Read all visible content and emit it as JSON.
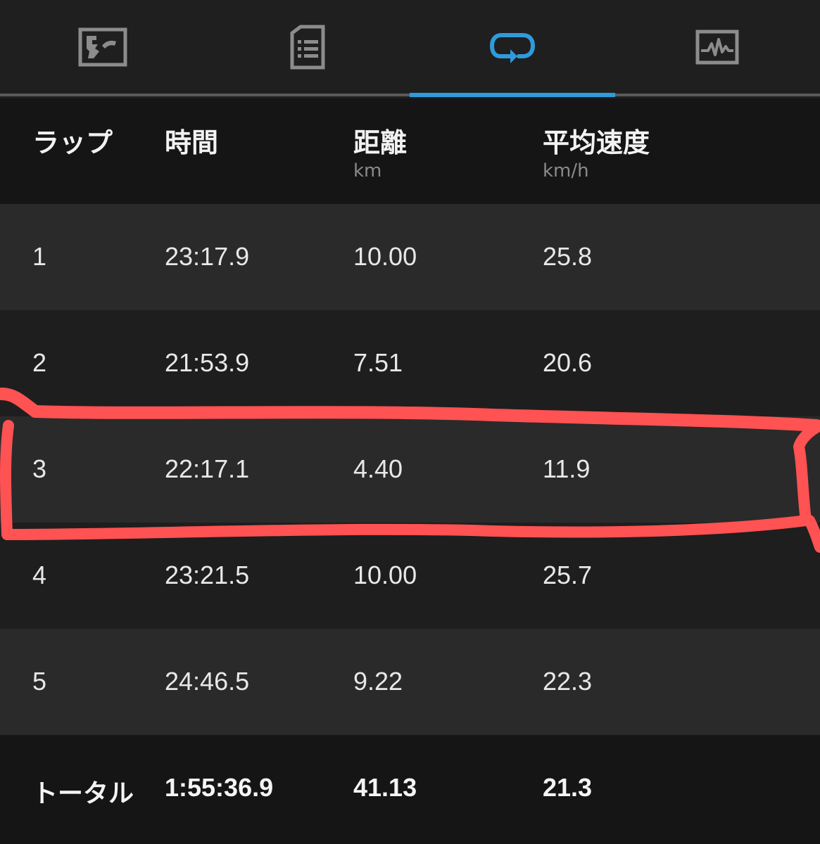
{
  "tabs": [
    {
      "name": "map-icon"
    },
    {
      "name": "details-list-icon"
    },
    {
      "name": "laps-icon",
      "active": true
    },
    {
      "name": "chart-icon"
    }
  ],
  "colors": {
    "accent": "#2f9bdb",
    "annotation": "#ff5252"
  },
  "table": {
    "headers": [
      {
        "title": "ラップ",
        "unit": ""
      },
      {
        "title": "時間",
        "unit": ""
      },
      {
        "title": "距離",
        "unit": "km"
      },
      {
        "title": "平均速度",
        "unit": "km/h"
      }
    ],
    "rows": [
      {
        "lap": "1",
        "time": "23:17.9",
        "distance": "10.00",
        "speed": "25.8"
      },
      {
        "lap": "2",
        "time": "21:53.9",
        "distance": "7.51",
        "speed": "20.6"
      },
      {
        "lap": "3",
        "time": "22:17.1",
        "distance": "4.40",
        "speed": "11.9"
      },
      {
        "lap": "4",
        "time": "23:21.5",
        "distance": "10.00",
        "speed": "25.7"
      },
      {
        "lap": "5",
        "time": "24:46.5",
        "distance": "9.22",
        "speed": "22.3"
      }
    ],
    "total": {
      "label": "トータル",
      "time": "1:55:36.9",
      "distance": "41.13",
      "speed": "21.3"
    }
  }
}
